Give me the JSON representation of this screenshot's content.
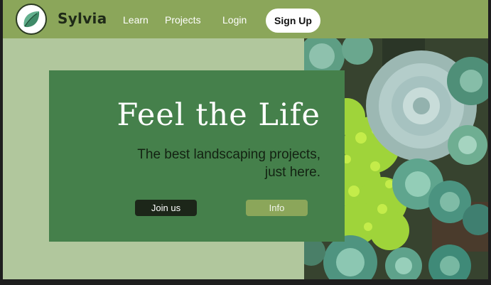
{
  "brand": {
    "name": "Sylvia",
    "logo_icon": "leaf-icon"
  },
  "nav": {
    "links": [
      {
        "label": "Learn"
      },
      {
        "label": "Projects"
      },
      {
        "label": "Login"
      }
    ],
    "signup_label": "Sign Up"
  },
  "hero": {
    "title": "Feel the Life",
    "subtitle_line1": "The best landscaping projects,",
    "subtitle_line2": "just here.",
    "primary_button": "Join us",
    "secondary_button": "Info"
  },
  "colors": {
    "page_background": "#b1c79d",
    "navbar": "#8ba65a",
    "hero_card": "#45804b",
    "dark_button": "#1c2619",
    "accent_button": "#8ba65a"
  }
}
